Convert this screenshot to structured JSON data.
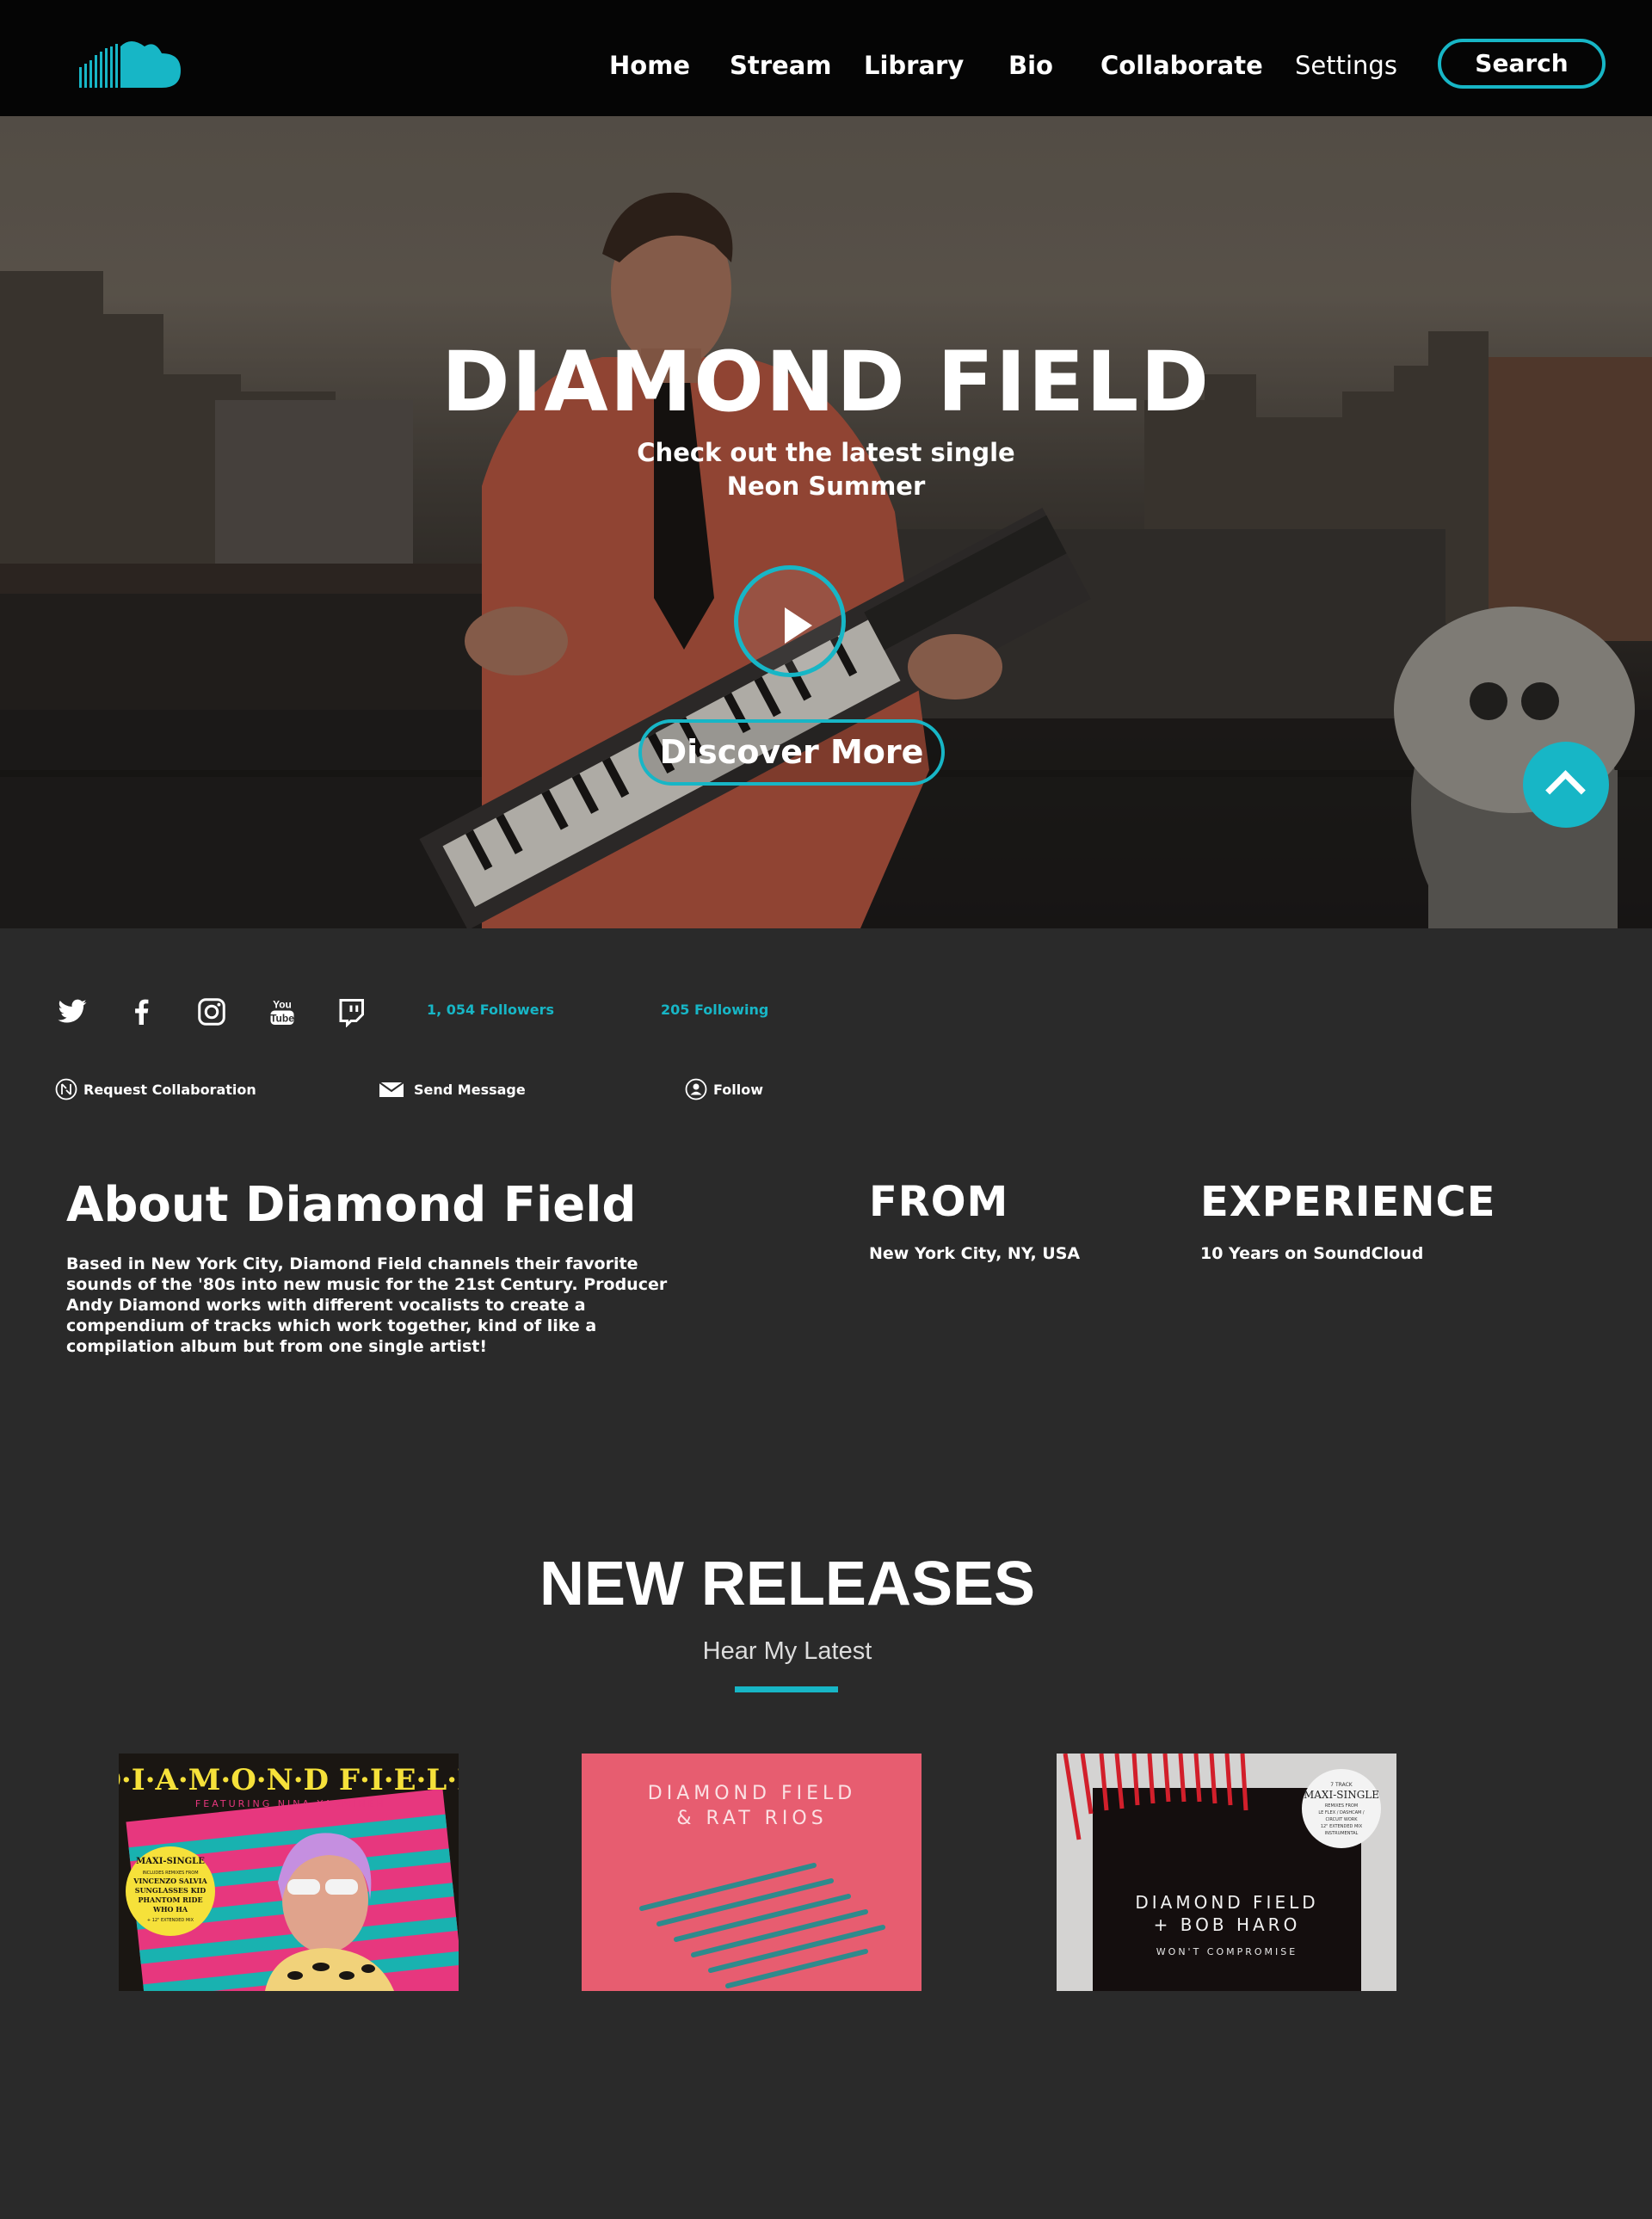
{
  "header": {
    "logo_icon": "soundcloud-cloud-icon",
    "nav": [
      "Home",
      "Stream",
      "Library",
      "Bio",
      "Collaborate",
      "Settings"
    ],
    "search_label": "Search"
  },
  "hero": {
    "title": "DIAMOND FIELD",
    "subtitle_line1": "Check out the latest single",
    "subtitle_line2": "Neon Summer",
    "play_icon": "play-icon",
    "discover_label": "Discover More",
    "scroll_icon": "chevron-up-icon"
  },
  "social": {
    "icons": [
      "twitter-icon",
      "facebook-icon",
      "instagram-icon",
      "youtube-icon",
      "twitch-icon"
    ],
    "followers": "1, 054 Followers",
    "following": "205  Following"
  },
  "actions": {
    "collab": "Request Collaboration",
    "message": "Send Message",
    "follow": "Follow"
  },
  "about": {
    "title": "About Diamond Field",
    "body": "Based in New York City, Diamond Field channels their favorite sounds of the '80s into new music for the 21st Century. Producer Andy Diamond works with different vocalists to create a compendium of tracks which work together, kind of like a compilation album but from one single artist!",
    "from_label": "FROM",
    "from_value": "New York City, NY, USA",
    "exp_label": "EXPERIENCE",
    "exp_value": "10 Years on SoundCloud"
  },
  "releases": {
    "title": "NEW RELEASES",
    "subtitle": "Hear My Latest",
    "accent_color": "#17b6c6",
    "covers": [
      {
        "title": "D·I·A·M·O·N·D F·I·E·L·D",
        "featuring": "FEATURING NINA YASMINEH",
        "badge_title": "MAXI-SINGLE",
        "badge_lines": [
          "INCLUDES REMIXES FROM",
          "VINCENZO SALVIA",
          "SUNGLASSES KID",
          "PHANTOM RIDE",
          "WHO HA",
          "+ 12\" EXTENDED MIX"
        ]
      },
      {
        "line1": "DIAMOND FIELD",
        "line2": "& RAT RIOS"
      },
      {
        "line1": "DIAMOND FIELD",
        "line2": "+ BOB HARO",
        "line3": "WON'T COMPROMISE",
        "badge_line1": "7 TRACK",
        "badge_title": "MAXI-SINGLE",
        "badge_lines": [
          "REMIXES FROM",
          "LE FLEX / DASHCAM /",
          "CIRCUIT WORK",
          "12\" EXTENDED MIX",
          "INSTRUMENTAL"
        ]
      }
    ]
  }
}
